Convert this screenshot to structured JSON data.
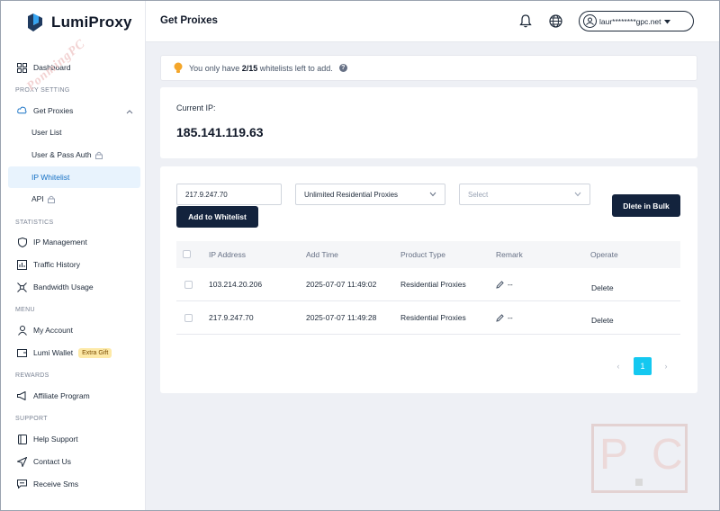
{
  "brand": {
    "name": "LumiProxy"
  },
  "header": {
    "title": "Get Proixes",
    "user_email": "laur********gpc.net"
  },
  "sidebar": {
    "dashboard": "Dashboard",
    "sections": {
      "proxy": "PROXY SETTING",
      "stats": "STATISTICS",
      "menu": "MENU",
      "rewards": "REWARDS",
      "support": "SUPPORT"
    },
    "get_proxies": "Get Proxies",
    "user_list": "User List",
    "user_pass": "User & Pass Auth",
    "ip_whitelist": "IP Whitelist",
    "api": "API",
    "ip_management": "IP Management",
    "traffic_history": "Traffic History",
    "bandwidth_usage": "Bandwidth Usage",
    "my_account": "My Account",
    "lumi_wallet": "Lumi Wallet",
    "extra_gift": "Extra Gift",
    "affiliate": "Affiliate Program",
    "help_support": "Help Support",
    "contact_us": "Contact Us",
    "receive_sms": "Receive Sms"
  },
  "notice": {
    "prefix": "You only have ",
    "count": "2/15",
    "suffix": " whitelists left to add."
  },
  "current_ip": {
    "label": "Current IP:",
    "value": "185.141.119.63"
  },
  "form": {
    "ip_value": "217.9.247.70",
    "product_select": "Unlimited Residential Proxies",
    "select_placeholder": "Select",
    "add_button": "Add to Whitelist",
    "bulk_button": "Dlete in Bulk"
  },
  "table": {
    "headers": [
      "IP Address",
      "Add Time",
      "Product Type",
      "Remark",
      "Operate"
    ],
    "rows": [
      {
        "ip": "103.214.20.206",
        "time": "2025-07-07 11:49:02",
        "type": "Residential Proxies",
        "remark": "--",
        "op": "Delete"
      },
      {
        "ip": "217.9.247.70",
        "time": "2025-07-07 11:49:28",
        "type": "Residential Proxies",
        "remark": "--",
        "op": "Delete"
      }
    ]
  },
  "pagination": {
    "current": "1",
    "prev": "‹",
    "next": "›"
  },
  "watermark": {
    "text": "PonmingPC",
    "letters": "PC"
  }
}
